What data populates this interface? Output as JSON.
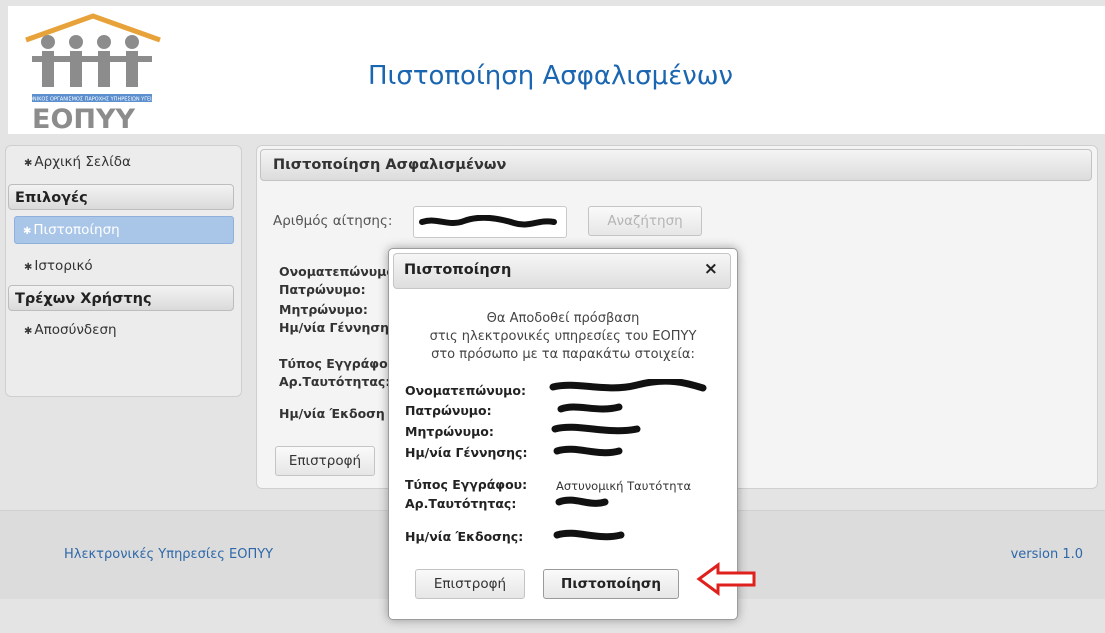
{
  "header": {
    "title": "Πιστοποίηση Ασφαλισμένων",
    "logo_text": "ΕΟΠΥΥ",
    "logo_subtext": "ΕΘΝΙΚΟΣ ΟΡΓΑΝΙΣΜΟΣ ΠΑΡΟΧΗΣ ΥΠΗΡΕΣΙΩΝ ΥΓΕΙΑΣ"
  },
  "sidebar": {
    "home": "Αρχική Σελίδα",
    "options_heading": "Επιλογές",
    "certification": "Πιστοποίηση",
    "history": "Ιστορικό",
    "current_user_heading": "Τρέχων Χρήστης",
    "logout": "Αποσύνδεση"
  },
  "main": {
    "heading": "Πιστοποίηση Ασφαλισμένων",
    "request_label": "Αριθμός αίτησης:",
    "search_button": "Αναζήτηση",
    "labels": {
      "fullname": "Ονοματεπώνυμο",
      "fathers_name": "Πατρώνυμο:",
      "mothers_name": "Μητρώνυμο:",
      "birth_date": "Ημ/νία Γέννηση",
      "doc_type": "Τύπος Εγγράφο",
      "id_number": "Αρ.Ταυτότητας:",
      "issue_date": "Ημ/νία Έκδοση"
    },
    "back_button": "Επιστροφή"
  },
  "modal": {
    "title": "Πιστοποίηση",
    "close": "×",
    "message_line1": "Θα Αποδοθεί πρόσβαση",
    "message_line2": "στις ηλεκτρονικές υπηρεσίες του ΕΟΠΥΥ",
    "message_line3": "στο πρόσωπο με τα παρακάτω στοιχεία:",
    "labels": {
      "fullname": "Ονοματεπώνυμο:",
      "fathers_name": "Πατρώνυμο:",
      "mothers_name": "Μητρώνυμο:",
      "birth_date": "Ημ/νία Γέννησης:",
      "doc_type": "Τύπος Εγγράφου:",
      "id_number": "Αρ.Ταυτότητας:",
      "issue_date": "Ημ/νία Έκδοσης:"
    },
    "doc_type_value": "Αστυνομική Ταυτότητα",
    "back_button": "Επιστροφή",
    "certify_button": "Πιστοποίηση"
  },
  "footer": {
    "left": "Ηλεκτρονικές Υπηρεσίες ΕΟΠΥΥ",
    "right": "version 1.0"
  },
  "colors": {
    "title_blue": "#1a66b0",
    "active_item": "#a9c6e8",
    "arrow_red": "#e0201c"
  }
}
